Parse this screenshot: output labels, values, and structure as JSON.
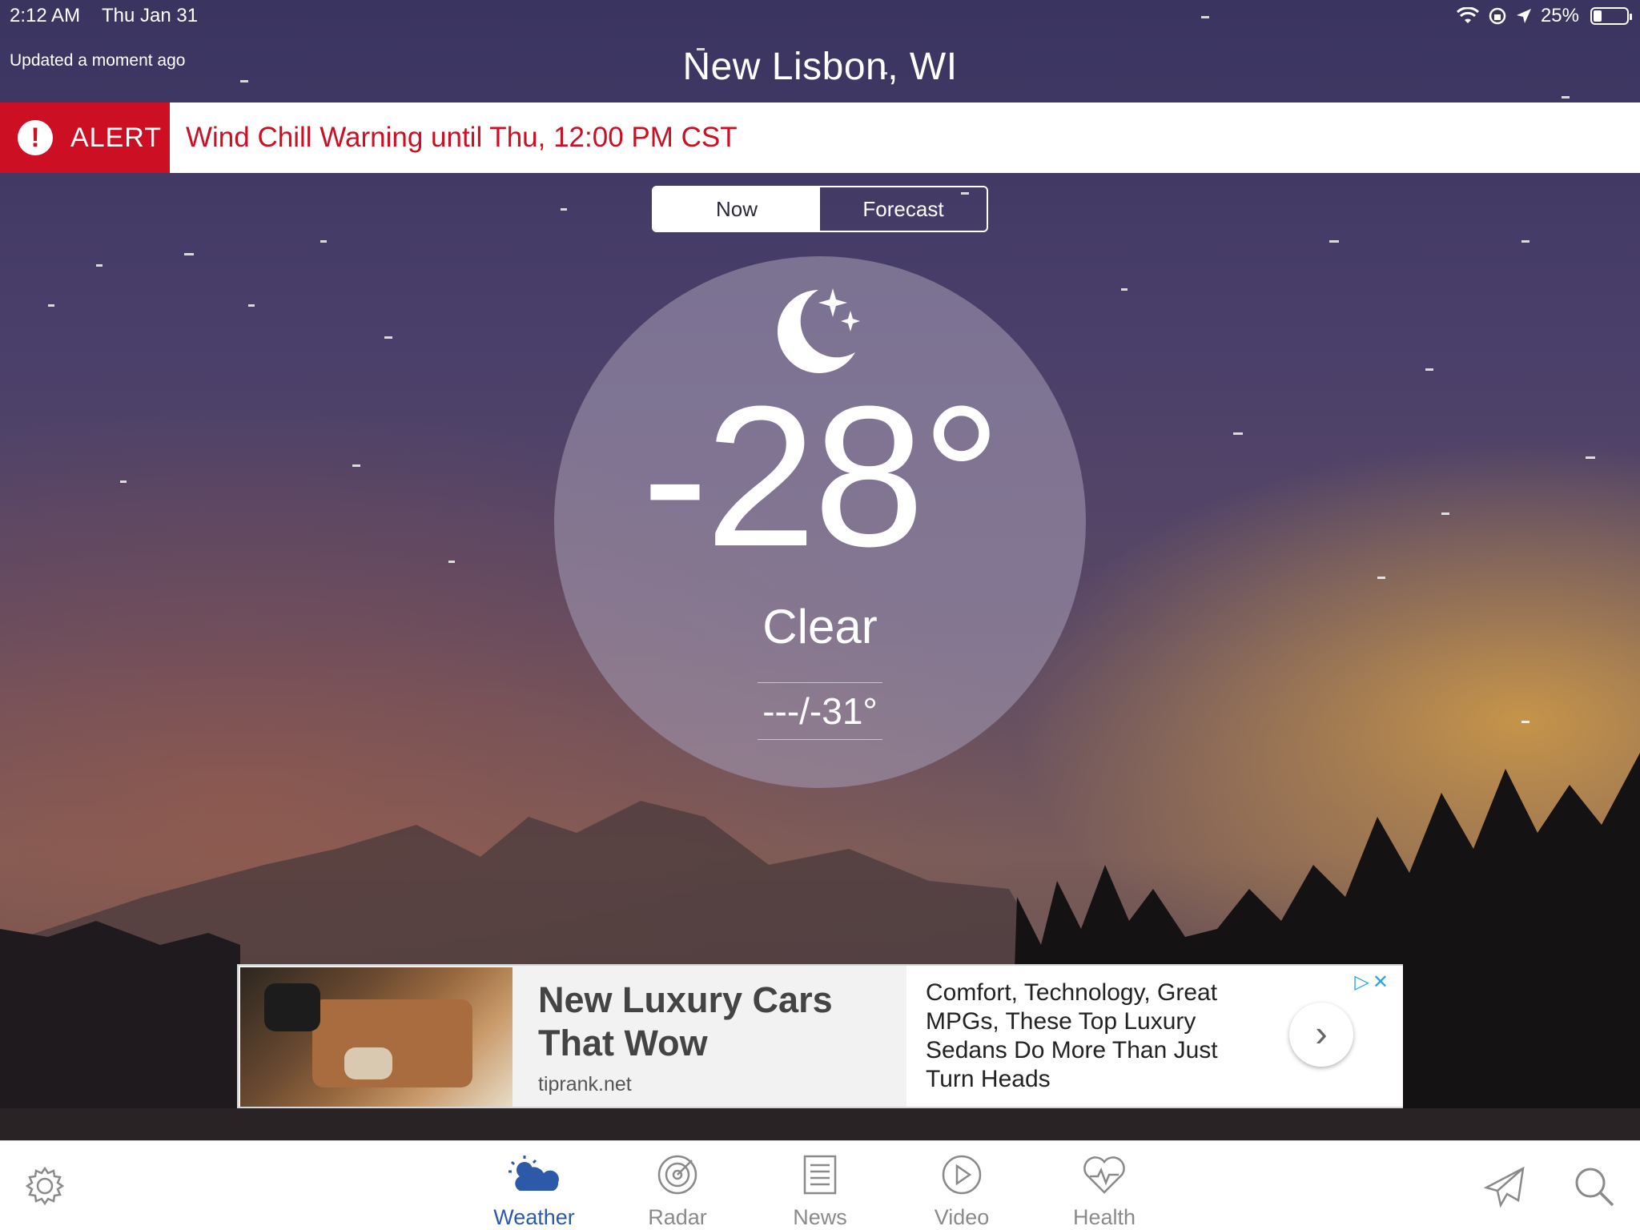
{
  "status_bar": {
    "time": "2:12 AM",
    "date": "Thu Jan 31",
    "battery_text": "25%",
    "battery_level": 0.25,
    "icons": [
      "wifi-icon",
      "orientation-lock-icon",
      "location-icon",
      "battery-icon"
    ]
  },
  "header": {
    "updated": "Updated a moment ago",
    "location": "New Lisbon, WI"
  },
  "alert": {
    "label": "ALERT",
    "text": "Wind Chill Warning  until Thu, 12:00 PM CST",
    "color": "#cc0f23"
  },
  "segments": {
    "now": "Now",
    "forecast": "Forecast",
    "selected": "Now"
  },
  "current": {
    "icon": "moon-stars-icon",
    "temperature": "-28°",
    "condition": "Clear",
    "hi_lo": "---/-31°"
  },
  "ad": {
    "headline": "New Luxury Cars That Wow",
    "source": "tiprank.net",
    "description": "Comfort, Technology, Great MPGs, These Top Luxury Sedans Do More Than Just Turn Heads",
    "adchoices_color": "#2aa6e0"
  },
  "tabbar": {
    "active_color": "#2c5aa8",
    "tabs": [
      {
        "label": "Weather",
        "icon": "weather-icon"
      },
      {
        "label": "Radar",
        "icon": "radar-icon"
      },
      {
        "label": "News",
        "icon": "news-icon"
      },
      {
        "label": "Video",
        "icon": "video-icon"
      },
      {
        "label": "Health",
        "icon": "health-icon"
      }
    ],
    "left_icon": "settings-gear-icon",
    "right_icons": [
      "airplane-icon",
      "search-icon"
    ]
  }
}
